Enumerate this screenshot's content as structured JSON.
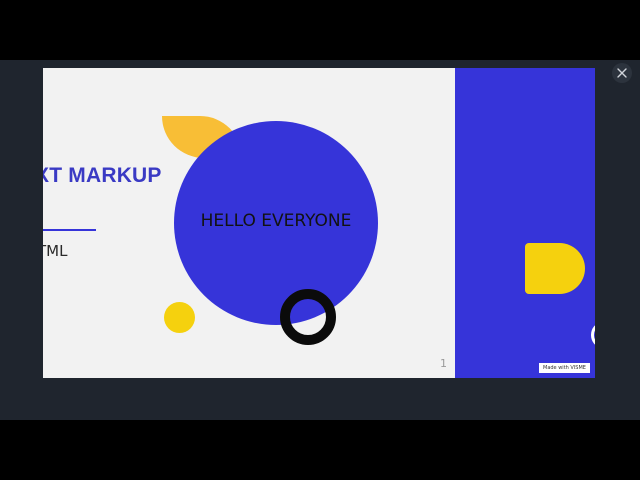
{
  "viewer": {
    "close_icon": "close-icon"
  },
  "slide": {
    "title": "XT MARKUP",
    "subtitle": "TML",
    "center_text": "HELLO EVERYONE",
    "page_number": "1"
  },
  "next_slide": {
    "badge": "Made with VISME"
  },
  "colors": {
    "accent_blue": "#3634d9",
    "accent_yellow": "#f5d10e",
    "accent_orange_yellow": "#f8be36",
    "slide_bg": "#f2f2f2",
    "viewer_bg": "#1f252e"
  }
}
